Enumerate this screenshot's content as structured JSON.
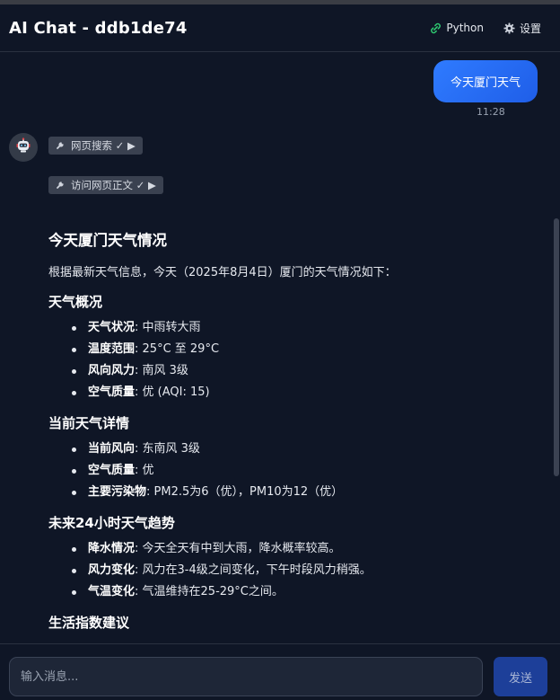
{
  "header": {
    "title": "AI Chat - ddb1de74",
    "python_label": "Python",
    "settings_label": "设置",
    "python_icon": "python-icon",
    "settings_icon": "gear-icon"
  },
  "conversation": {
    "user_message": {
      "text": "今天厦门天气",
      "time": "11:28"
    },
    "tool_calls": [
      {
        "label": "网页搜索 ✓ ▶",
        "icon": "wrench-icon"
      },
      {
        "label": "访问网页正文 ✓ ▶",
        "icon": "wrench-icon"
      }
    ],
    "answer": {
      "title": "今天厦门天气情况",
      "intro": "根据最新天气信息，今天（2025年8月4日）厦门的天气情况如下：",
      "sections": [
        {
          "heading": "天气概况",
          "items": [
            {
              "label": "天气状况",
              "value": ": 中雨转大雨"
            },
            {
              "label": "温度范围",
              "value": ": 25°C 至 29°C"
            },
            {
              "label": "风向风力",
              "value": ": 南风 3级"
            },
            {
              "label": "空气质量",
              "value": ": 优 (AQI: 15)"
            }
          ]
        },
        {
          "heading": "当前天气详情",
          "items": [
            {
              "label": "当前风向",
              "value": ": 东南风 3级"
            },
            {
              "label": "空气质量",
              "value": ": 优"
            },
            {
              "label": "主要污染物",
              "value": ": PM2.5为6（优），PM10为12（优）"
            }
          ]
        },
        {
          "heading": "未来24小时天气趋势",
          "items": [
            {
              "label": "降水情况",
              "value": ": 今天全天有中到大雨，降水概率较高。"
            },
            {
              "label": "风力变化",
              "value": ": 风力在3-4级之间变化，下午时段风力稍强。"
            },
            {
              "label": "气温变化",
              "value": ": 气温维持在25-29°C之间。"
            }
          ]
        },
        {
          "heading": "生活指数建议",
          "items": []
        }
      ]
    }
  },
  "input": {
    "placeholder": "输入消息...",
    "send_label": "发送"
  },
  "colors": {
    "background": "#0f1626",
    "user_bubble": "#2f7bff",
    "send_button": "#1d3f99",
    "python_icon": "#2ecc71"
  }
}
